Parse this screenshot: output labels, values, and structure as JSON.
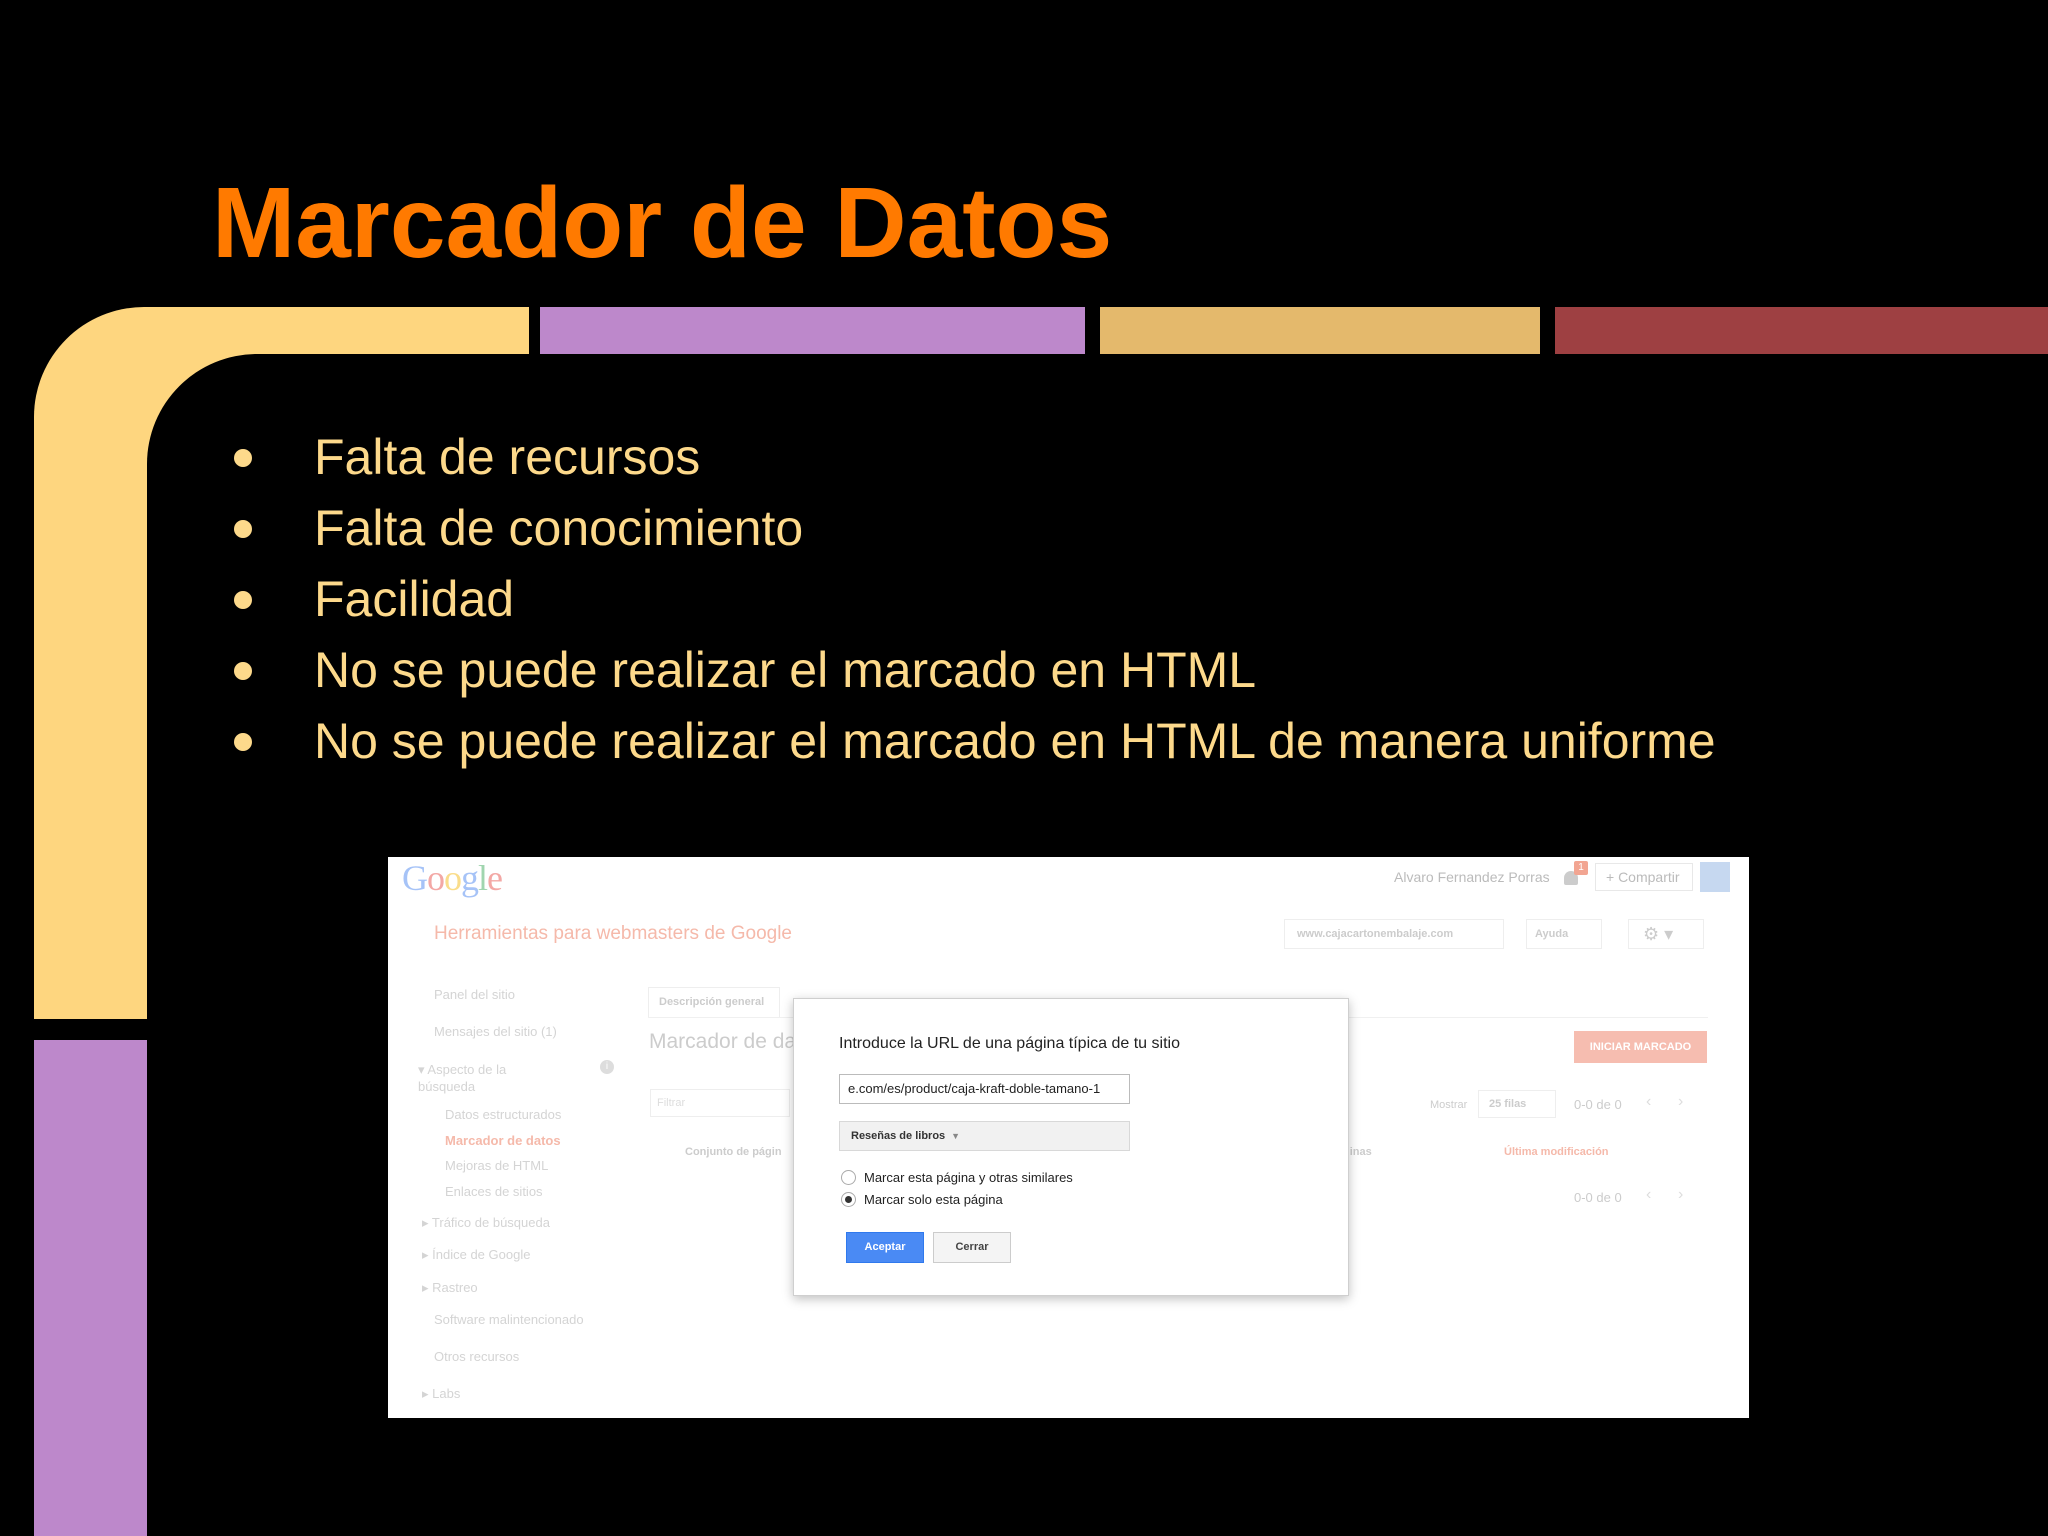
{
  "slide": {
    "title": "Marcador de Datos",
    "bullets": [
      "Falta de recursos",
      "Falta de conocimiento",
      "Facilidad",
      "No se puede realizar el marcado en HTML",
      "No se puede realizar el marcado en HTML de manera uniforme"
    ],
    "colors": {
      "title": "#FF7A00",
      "bullet_text": "#FDD98B",
      "deco_yellow": "#FED67F",
      "deco_purple": "#BD88CB",
      "deco_gold": "#E4B96C",
      "deco_red": "#9E4042"
    }
  },
  "screenshot": {
    "logo": "Google",
    "user_name": "Alvaro Fernandez Porras",
    "notifications_badge": "1",
    "share_label": "+ Compartir",
    "app_title": "Herramientas para webmasters de Google",
    "site_selector": "www.cajacartonembalaje.com",
    "help_label": "Ayuda",
    "nav": {
      "panel": "Panel del sitio",
      "messages": "Mensajes del sitio (1)",
      "search_appearance": "Aspecto de la búsqueda",
      "structured_data": "Datos estructurados",
      "data_highlighter": "Marcador de datos",
      "html_improvements": "Mejoras de HTML",
      "sitelinks": "Enlaces de sitios",
      "search_traffic": "Tráfico de búsqueda",
      "google_index": "Índice de Google",
      "crawl": "Rastreo",
      "malware": "Software malintencionado",
      "other_resources": "Otros recursos",
      "labs": "Labs"
    },
    "tab_label": "Descripción general",
    "page_heading": "Marcador de da",
    "start_button": "INICIAR MARCADO",
    "filter_placeholder": "Filtrar",
    "show_label": "Mostrar",
    "rows_label": "25 filas",
    "pager_text": "0-0 de 0",
    "columns": {
      "page_set": "Conjunto de págin",
      "pages": "ginas",
      "last_modified": "Última modificación"
    },
    "dialog": {
      "title": "Introduce la URL de una página típica de tu sitio",
      "url_value": "e.com/es/product/caja-kraft-doble-tamano-1",
      "type_selected": "Reseñas de libros",
      "radio_similar": "Marcar esta página y otras similares",
      "radio_only": "Marcar solo esta página",
      "accept_label": "Aceptar",
      "close_label": "Cerrar"
    }
  }
}
